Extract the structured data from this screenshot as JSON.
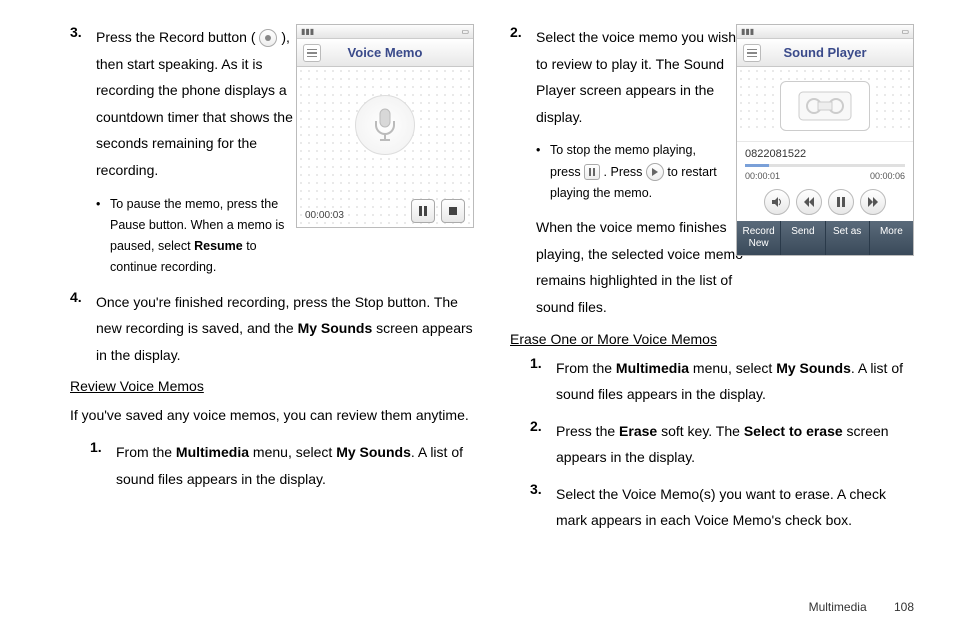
{
  "left": {
    "step3_a": "Press the Record button (",
    "step3_b": "), then start speaking. As it is recording the phone displays a countdown timer that shows the seconds remaining for the recording.",
    "step3_bullet_a": "To pause the memo, press the Pause button. When a memo is paused, select ",
    "step3_bullet_bold": "Resume",
    "step3_bullet_b": " to continue recording.",
    "step4_a": "Once you're finished recording, press the Stop button. The new recording is saved, and the ",
    "step4_bold": "My Sounds",
    "step4_b": " screen appears in the display.",
    "heading": "Review Voice Memos",
    "para": "If you've saved any voice memos, you can review them anytime.",
    "rv1_a": "From the ",
    "rv1_b1": "Multimedia",
    "rv1_c": " menu, select ",
    "rv1_b2": "My Sounds",
    "rv1_d": ". A list of sound files appears in the display."
  },
  "right": {
    "step2": "Select the voice memo you wish to review to play it. The Sound Player screen appears in the display.",
    "step2_bullet_a": "To stop the memo playing, press ",
    "step2_bullet_b": ". Press ",
    "step2_bullet_c": " to restart playing the memo.",
    "step2_after": "When the voice memo finishes playing, the selected voice memo remains highlighted in the list of sound files.",
    "heading": "Erase One or More Voice Memos",
    "e1_a": "From the ",
    "e1_b1": "Multimedia",
    "e1_c": " menu, select ",
    "e1_b2": "My Sounds",
    "e1_d": ". A list of sound files appears in the display.",
    "e2_a": "Press the ",
    "e2_b1": "Erase",
    "e2_c": " soft key. The ",
    "e2_b2": "Select to erase",
    "e2_d": " screen appears in the display.",
    "e3": "Select the Voice Memo(s) you want to erase. A check mark appears in each Voice Memo's check box."
  },
  "phone_vm": {
    "title": "Voice Memo",
    "time": "00:00:03"
  },
  "phone_sp": {
    "title": "Sound Player",
    "filename": "0822081522",
    "time_l": "00:00:01",
    "time_r": "00:00:06",
    "soft1": "Record New",
    "soft2": "Send",
    "soft3": "Set as",
    "soft4": "More"
  },
  "footer": {
    "section": "Multimedia",
    "page": "108"
  },
  "nums": {
    "n1": "1.",
    "n2": "2.",
    "n3": "3.",
    "n4": "4."
  }
}
